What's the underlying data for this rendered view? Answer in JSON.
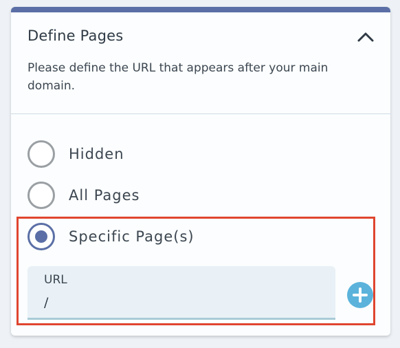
{
  "panel": {
    "title": "Define Pages",
    "description": "Please define the URL that appears after your main domain.",
    "accent_color": "#5b6fa6"
  },
  "options": [
    {
      "label": "Hidden",
      "checked": false
    },
    {
      "label": "All Pages",
      "checked": false
    },
    {
      "label": "Specific Page(s)",
      "checked": true
    }
  ],
  "url_field": {
    "label": "URL",
    "value": "/"
  },
  "icons": {
    "collapse": "chevron-up-icon",
    "add": "plus-circle-icon"
  },
  "colors": {
    "highlight": "#e0452f",
    "add_button": "#5bb3db"
  }
}
